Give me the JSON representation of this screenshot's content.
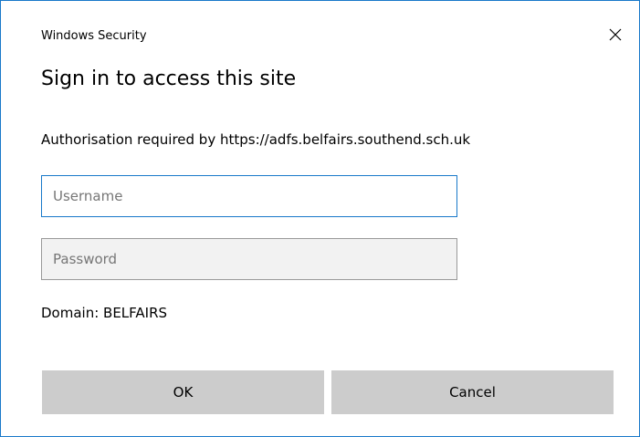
{
  "window": {
    "title": "Windows Security",
    "close_icon": "close-icon"
  },
  "dialog": {
    "heading": "Sign in to access this site",
    "authorisation_text": "Authorisation required by https://adfs.belfairs.southend.sch.uk",
    "domain_text": "Domain: BELFAIRS"
  },
  "fields": {
    "username": {
      "value": "",
      "placeholder": "Username"
    },
    "password": {
      "value": "",
      "placeholder": "Password"
    }
  },
  "buttons": {
    "ok_label": "OK",
    "cancel_label": "Cancel"
  },
  "colors": {
    "accent": "#1979ca",
    "button_bg": "#cccccc",
    "disabled_field_bg": "#f2f2f2"
  }
}
